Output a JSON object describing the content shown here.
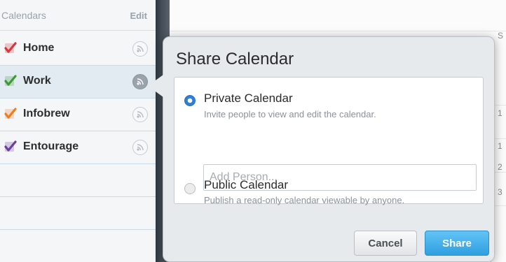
{
  "sidebar": {
    "title": "Calendars",
    "edit_label": "Edit",
    "calendars": [
      {
        "name": "Home",
        "color": "#d9353a",
        "selected": false
      },
      {
        "name": "Work",
        "color": "#3d9b32",
        "selected": true
      },
      {
        "name": "Infobrew",
        "color": "#ee7d22",
        "selected": false
      },
      {
        "name": "Entourage",
        "color": "#6a3fa0",
        "selected": false
      }
    ],
    "share_icon": "broadcast-icon"
  },
  "background_calendar": {
    "column_labels": [
      "S",
      "1",
      "1",
      "2",
      "3"
    ]
  },
  "popover": {
    "title": "Share Calendar",
    "options": [
      {
        "title": "Private Calendar",
        "description": "Invite people to view and edit the calendar.",
        "selected": true
      },
      {
        "title": "Public Calendar",
        "description": "Publish a read-only calendar viewable by anyone.",
        "selected": false
      }
    ],
    "add_person": {
      "value": "",
      "placeholder": "Add Person..."
    },
    "cancel_label": "Cancel",
    "share_label": "Share"
  },
  "colors": {
    "accent": "#2f7ed8",
    "share_button": "#3aa9e8"
  }
}
